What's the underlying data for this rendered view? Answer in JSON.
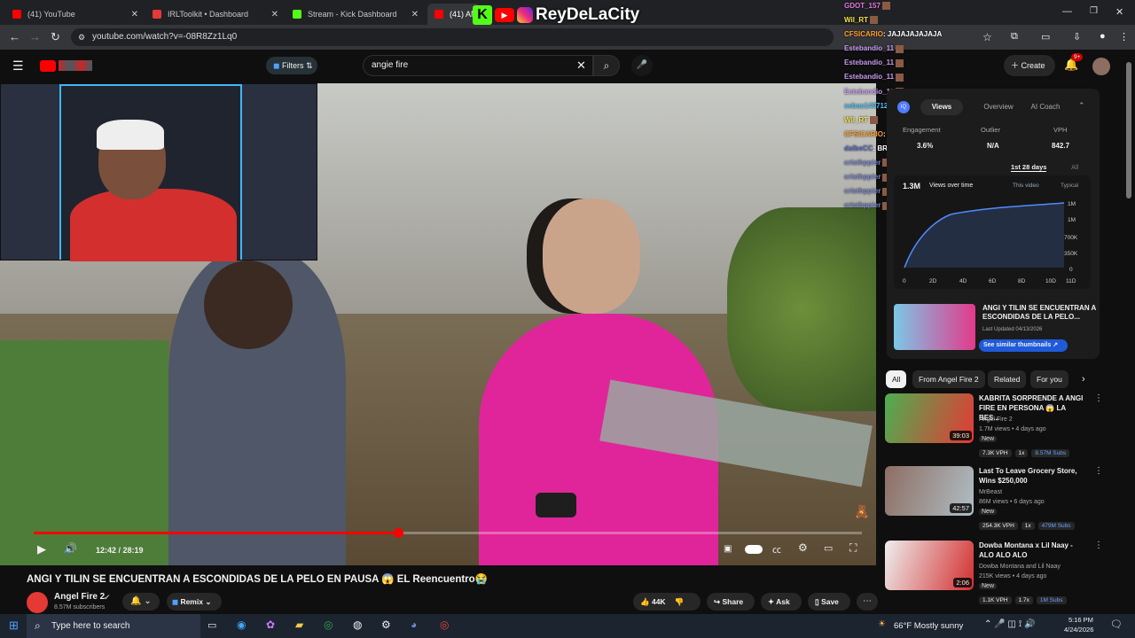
{
  "tabs": [
    {
      "label": "(41) YouTube",
      "color": "#ff0000"
    },
    {
      "label": "IRLToolkit • Dashboard",
      "color": "#e53935"
    },
    {
      "label": "Stream - Kick Dashboard",
      "color": "#53fc18"
    },
    {
      "label": "(41) AN",
      "color": "#ff0000"
    }
  ],
  "overlay_brand": "ReyDeLaCity",
  "url": "youtube.com/watch?v=-08R8Zz1Lq0",
  "search": {
    "query": "angie fire"
  },
  "filters_label": "Filters",
  "create_label": "Create",
  "notif_count": "9+",
  "chat": [
    {
      "user": "GDOT_157",
      "color": "#e27ae2",
      "text": ""
    },
    {
      "user": "Wil_RT",
      "color": "#f3e14b",
      "text": ""
    },
    {
      "user": "CFSICARIO",
      "color": "#ff9d2d",
      "text": ": JAJAJAJAJAJA"
    },
    {
      "user": "Estebandio_11",
      "color": "#c89cf0",
      "text": ""
    },
    {
      "user": "Estebandio_11",
      "color": "#c89cf0",
      "text": ""
    },
    {
      "user": "Estebandio_11",
      "color": "#c89cf0",
      "text": ""
    },
    {
      "user": "Estebandio_11",
      "color": "#c89cf0",
      "text": ""
    },
    {
      "user": "sebas140712",
      "color": "#4fc3f7",
      "text": ""
    },
    {
      "user": "Wil_RT",
      "color": "#f3e14b",
      "text": ""
    },
    {
      "user": "CFSICARIO",
      "color": "#ff9d2d",
      "text": ": JAJAJAJAJA"
    },
    {
      "user": "dalbeCC",
      "color": "#5c6bc0",
      "text": ": BRO TU TE ENTRETIENES ENSERIO"
    },
    {
      "user": "cristhppier",
      "color": "#7986cb",
      "text": ""
    },
    {
      "user": "cristhppier",
      "color": "#7986cb",
      "text": ""
    },
    {
      "user": "cristhppier",
      "color": "#7986cb",
      "text": ""
    },
    {
      "user": "cristhppier",
      "color": "#7986cb",
      "text": ""
    }
  ],
  "video": {
    "time": "12:42 / 28:19",
    "progress": 0.44,
    "title": "ANGI Y TILIN SE ENCUENTRAN A ESCONDIDAS DE LA PELO EN PAUSA 😱 EL Reencuentro😭"
  },
  "channel": {
    "name": "Angel Fire 2",
    "subs": "8.57M subscribers",
    "remix": "Remix"
  },
  "actions": {
    "likes": "44K",
    "share": "Share",
    "ask": "Ask",
    "save": "Save"
  },
  "panel": {
    "tabs": [
      "Views",
      "Overview",
      "AI Coach"
    ],
    "stats": [
      {
        "label": "Engagement",
        "value": "3.6%"
      },
      {
        "label": "Outlier",
        "value": "N/A"
      },
      {
        "label": "VPH",
        "value": "842.7"
      }
    ],
    "period": "1st 28 days",
    "period_all": "All",
    "views": "1.3M",
    "views_over_time": "Views over time",
    "legend_this": "This video",
    "legend_typical": "Typical",
    "yticks": [
      "1M",
      "1M",
      "700K",
      "350K",
      "0"
    ],
    "xticks": [
      "0",
      "2D",
      "4D",
      "6D",
      "8D",
      "10D",
      "11D"
    ],
    "promo_title": "ANGI Y TILIN SE ENCUENTRAN A ESCONDIDAS DE LA PELO...",
    "promo_updated": "Last Updated 04/13/2026",
    "promo_button": "See similar thumbnails"
  },
  "chips": [
    "All",
    "From Angel Fire 2",
    "Related",
    "For you"
  ],
  "recs": [
    {
      "title": "KABRITA SORPRENDE A ANGI FIRE EN PERSONA 😱 LA BES...",
      "channel": "Angel Fire 2",
      "meta": "1.7M views • 4 days ago",
      "dur": "39:03",
      "new": "New",
      "vph": "7.3K VPH",
      "x": "1x",
      "subs": "8.57M Subs",
      "c1": "#4caf50",
      "c2": "#e53935"
    },
    {
      "title": "Last To Leave Grocery Store, Wins $250,000",
      "channel": "MrBeast",
      "meta": "86M views • 6 days ago",
      "dur": "42:57",
      "new": "New",
      "vph": "254.3K VPH",
      "x": "1x",
      "subs": "479M Subs",
      "c1": "#8d6e63",
      "c2": "#b0bec5"
    },
    {
      "title": "Dowba Montana x Lil Naay - ALO ALO ALO",
      "channel": "Dowba Montana and Lil Naay",
      "meta": "215K views • 4 days ago",
      "dur": "2:06",
      "new": "New",
      "vph": "1.1K VPH",
      "x": "1.7x",
      "subs": "1M Subs",
      "c1": "#eeeeee",
      "c2": "#d32f2f"
    }
  ],
  "taskbar": {
    "search": "Type here to search",
    "weather": "66°F  Mostly sunny",
    "time": "5:16 PM",
    "date": "4/24/2026"
  }
}
